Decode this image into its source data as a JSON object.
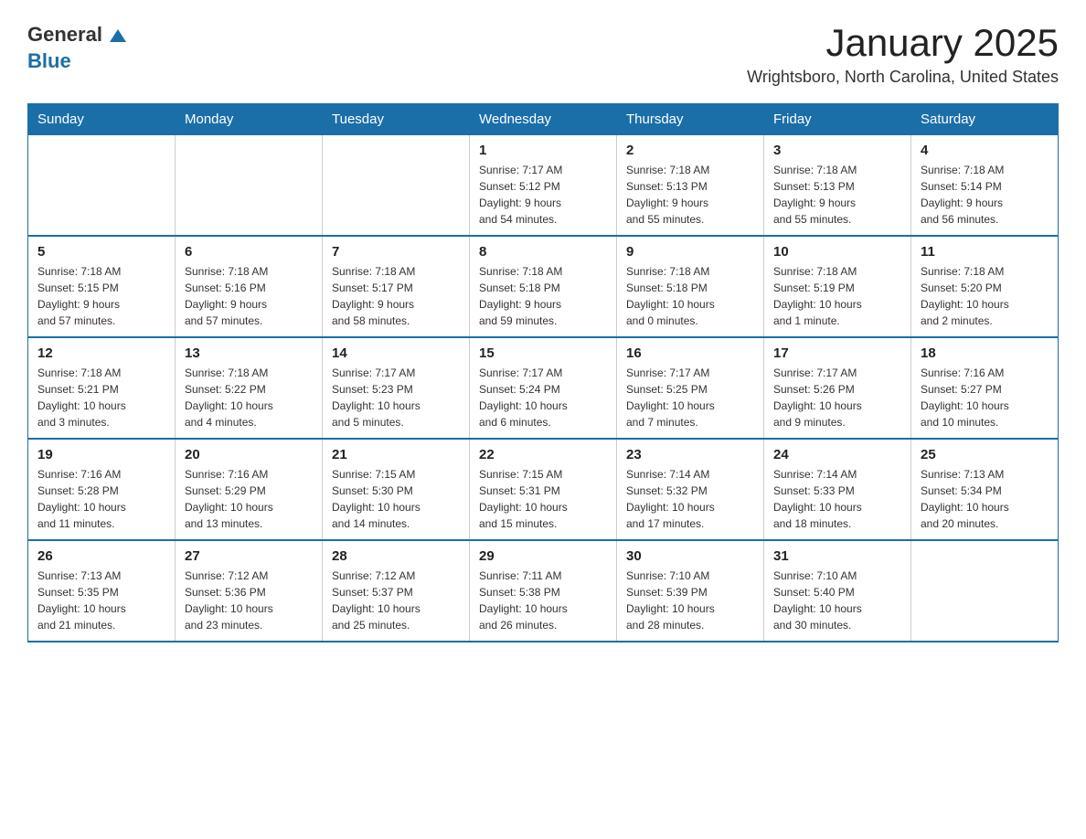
{
  "logo": {
    "general": "General",
    "blue": "Blue"
  },
  "title": "January 2025",
  "subtitle": "Wrightsboro, North Carolina, United States",
  "days_of_week": [
    "Sunday",
    "Monday",
    "Tuesday",
    "Wednesday",
    "Thursday",
    "Friday",
    "Saturday"
  ],
  "weeks": [
    [
      {
        "day": "",
        "info": ""
      },
      {
        "day": "",
        "info": ""
      },
      {
        "day": "",
        "info": ""
      },
      {
        "day": "1",
        "info": "Sunrise: 7:17 AM\nSunset: 5:12 PM\nDaylight: 9 hours\nand 54 minutes."
      },
      {
        "day": "2",
        "info": "Sunrise: 7:18 AM\nSunset: 5:13 PM\nDaylight: 9 hours\nand 55 minutes."
      },
      {
        "day": "3",
        "info": "Sunrise: 7:18 AM\nSunset: 5:13 PM\nDaylight: 9 hours\nand 55 minutes."
      },
      {
        "day": "4",
        "info": "Sunrise: 7:18 AM\nSunset: 5:14 PM\nDaylight: 9 hours\nand 56 minutes."
      }
    ],
    [
      {
        "day": "5",
        "info": "Sunrise: 7:18 AM\nSunset: 5:15 PM\nDaylight: 9 hours\nand 57 minutes."
      },
      {
        "day": "6",
        "info": "Sunrise: 7:18 AM\nSunset: 5:16 PM\nDaylight: 9 hours\nand 57 minutes."
      },
      {
        "day": "7",
        "info": "Sunrise: 7:18 AM\nSunset: 5:17 PM\nDaylight: 9 hours\nand 58 minutes."
      },
      {
        "day": "8",
        "info": "Sunrise: 7:18 AM\nSunset: 5:18 PM\nDaylight: 9 hours\nand 59 minutes."
      },
      {
        "day": "9",
        "info": "Sunrise: 7:18 AM\nSunset: 5:18 PM\nDaylight: 10 hours\nand 0 minutes."
      },
      {
        "day": "10",
        "info": "Sunrise: 7:18 AM\nSunset: 5:19 PM\nDaylight: 10 hours\nand 1 minute."
      },
      {
        "day": "11",
        "info": "Sunrise: 7:18 AM\nSunset: 5:20 PM\nDaylight: 10 hours\nand 2 minutes."
      }
    ],
    [
      {
        "day": "12",
        "info": "Sunrise: 7:18 AM\nSunset: 5:21 PM\nDaylight: 10 hours\nand 3 minutes."
      },
      {
        "day": "13",
        "info": "Sunrise: 7:18 AM\nSunset: 5:22 PM\nDaylight: 10 hours\nand 4 minutes."
      },
      {
        "day": "14",
        "info": "Sunrise: 7:17 AM\nSunset: 5:23 PM\nDaylight: 10 hours\nand 5 minutes."
      },
      {
        "day": "15",
        "info": "Sunrise: 7:17 AM\nSunset: 5:24 PM\nDaylight: 10 hours\nand 6 minutes."
      },
      {
        "day": "16",
        "info": "Sunrise: 7:17 AM\nSunset: 5:25 PM\nDaylight: 10 hours\nand 7 minutes."
      },
      {
        "day": "17",
        "info": "Sunrise: 7:17 AM\nSunset: 5:26 PM\nDaylight: 10 hours\nand 9 minutes."
      },
      {
        "day": "18",
        "info": "Sunrise: 7:16 AM\nSunset: 5:27 PM\nDaylight: 10 hours\nand 10 minutes."
      }
    ],
    [
      {
        "day": "19",
        "info": "Sunrise: 7:16 AM\nSunset: 5:28 PM\nDaylight: 10 hours\nand 11 minutes."
      },
      {
        "day": "20",
        "info": "Sunrise: 7:16 AM\nSunset: 5:29 PM\nDaylight: 10 hours\nand 13 minutes."
      },
      {
        "day": "21",
        "info": "Sunrise: 7:15 AM\nSunset: 5:30 PM\nDaylight: 10 hours\nand 14 minutes."
      },
      {
        "day": "22",
        "info": "Sunrise: 7:15 AM\nSunset: 5:31 PM\nDaylight: 10 hours\nand 15 minutes."
      },
      {
        "day": "23",
        "info": "Sunrise: 7:14 AM\nSunset: 5:32 PM\nDaylight: 10 hours\nand 17 minutes."
      },
      {
        "day": "24",
        "info": "Sunrise: 7:14 AM\nSunset: 5:33 PM\nDaylight: 10 hours\nand 18 minutes."
      },
      {
        "day": "25",
        "info": "Sunrise: 7:13 AM\nSunset: 5:34 PM\nDaylight: 10 hours\nand 20 minutes."
      }
    ],
    [
      {
        "day": "26",
        "info": "Sunrise: 7:13 AM\nSunset: 5:35 PM\nDaylight: 10 hours\nand 21 minutes."
      },
      {
        "day": "27",
        "info": "Sunrise: 7:12 AM\nSunset: 5:36 PM\nDaylight: 10 hours\nand 23 minutes."
      },
      {
        "day": "28",
        "info": "Sunrise: 7:12 AM\nSunset: 5:37 PM\nDaylight: 10 hours\nand 25 minutes."
      },
      {
        "day": "29",
        "info": "Sunrise: 7:11 AM\nSunset: 5:38 PM\nDaylight: 10 hours\nand 26 minutes."
      },
      {
        "day": "30",
        "info": "Sunrise: 7:10 AM\nSunset: 5:39 PM\nDaylight: 10 hours\nand 28 minutes."
      },
      {
        "day": "31",
        "info": "Sunrise: 7:10 AM\nSunset: 5:40 PM\nDaylight: 10 hours\nand 30 minutes."
      },
      {
        "day": "",
        "info": ""
      }
    ]
  ]
}
